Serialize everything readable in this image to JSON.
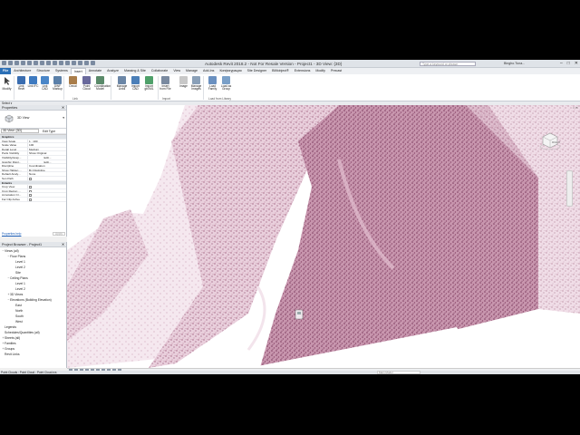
{
  "app": {
    "title": "Autodesk Revit 2018.2 - Not For Resale Version - Project1 - 3D View: {3D}",
    "search_placeholder": "Type a keyword or phrase",
    "user": "Bingho.Tuna...",
    "window_buttons": [
      "–",
      "□",
      "✕"
    ]
  },
  "ribbon": {
    "tabs": [
      "File",
      "Architecture",
      "Structure",
      "Systems",
      "Insert",
      "Annotate",
      "Analyze",
      "Massing & Site",
      "Collaborate",
      "View",
      "Manage",
      "Add-Ins",
      "Конфигурация",
      "Site Designer",
      "BIMobject®",
      "Extensions",
      "Modify",
      "Precast"
    ],
    "active_tab": "Insert",
    "modify_label": "Modify",
    "buttons": [
      {
        "label": "Link Revit",
        "icon": "link-revit-icon",
        "color": "#3a6db0"
      },
      {
        "label": "Link IFC",
        "icon": "link-ifc-icon",
        "color": "#3e7ac0"
      },
      {
        "label": "Link CAD",
        "icon": "link-cad-icon",
        "color": "#4a86c8"
      },
      {
        "label": "DWF Markup",
        "icon": "dwf-markup-icon",
        "color": "#5a7fa8"
      },
      {
        "label": "Decal",
        "icon": "decal-icon",
        "color": "#a97d4a"
      },
      {
        "label": "Point Cloud",
        "icon": "point-cloud-icon",
        "color": "#6a6a9c"
      },
      {
        "label": "Coordination Model",
        "icon": "coordination-model-icon",
        "color": "#5a8a6a"
      },
      {
        "label": "Manage Links",
        "icon": "manage-links-icon",
        "color": "#6b86a6"
      },
      {
        "label": "Import CAD",
        "icon": "import-cad-icon",
        "color": "#4b7fb8"
      },
      {
        "label": "Import gbXML",
        "icon": "import-gbxml-icon",
        "color": "#4fa06a"
      },
      {
        "label": "Insert from File",
        "icon": "insert-from-file-icon",
        "color": "#7a8aa0"
      },
      {
        "label": "Image",
        "icon": "image-icon",
        "color": "#c8c8c8"
      },
      {
        "label": "Manage Images",
        "icon": "manage-images-icon",
        "color": "#8aa0b8"
      },
      {
        "label": "Load Family",
        "icon": "load-family-icon",
        "color": "#6a90c0"
      },
      {
        "label": "Load as Group",
        "icon": "load-as-group-icon",
        "color": "#7aa0c8"
      }
    ],
    "panels": [
      "Link",
      "Import",
      "Load from Library"
    ]
  },
  "select_bar": "Select ▾",
  "properties": {
    "header": "Properties",
    "type_name": "3D View",
    "view_selector": "3D View: {3D}",
    "edit_type": "Edit Type",
    "rows": [
      {
        "cat": "Graphics"
      },
      {
        "k": "View Scale",
        "v": "1 : 100"
      },
      {
        "k": "Scale Value",
        "v": "100"
      },
      {
        "k": "Detail Level",
        "v": "Medium"
      },
      {
        "k": "Parts Visibility",
        "v": "Show Original"
      },
      {
        "k": "Visibility/Grap...",
        "v": "Edit...",
        "edit": true
      },
      {
        "k": "Graphic Displ...",
        "v": "Edit...",
        "edit": true
      },
      {
        "k": "Discipline",
        "v": "Coordination"
      },
      {
        "k": "Show Hidden ...",
        "v": "By Discipline"
      },
      {
        "k": "Default Analy...",
        "v": "None"
      },
      {
        "k": "Sun Path",
        "check": true
      },
      {
        "cat": "Extents"
      },
      {
        "k": "Crop View",
        "check": true
      },
      {
        "k": "Crop Region ...",
        "check": true
      },
      {
        "k": "Annotation Cr...",
        "check": true
      },
      {
        "k": "Far Clip Active",
        "check": true
      }
    ],
    "help_link": "Properties help",
    "apply": "Apply"
  },
  "project_browser": {
    "header": "Project Browser - Project1",
    "items": [
      {
        "label": "Views (all)",
        "indent": 0,
        "pm": "−"
      },
      {
        "label": "Floor Plans",
        "indent": 1,
        "pm": "−"
      },
      {
        "label": "Level 1",
        "indent": 2,
        "pm": ""
      },
      {
        "label": "Level 2",
        "indent": 2,
        "pm": ""
      },
      {
        "label": "Site",
        "indent": 2,
        "pm": ""
      },
      {
        "label": "Ceiling Plans",
        "indent": 1,
        "pm": "−"
      },
      {
        "label": "Level 1",
        "indent": 2,
        "pm": ""
      },
      {
        "label": "Level 2",
        "indent": 2,
        "pm": ""
      },
      {
        "label": "3D Views",
        "indent": 1,
        "pm": "+"
      },
      {
        "label": "Elevations (Building Elevation)",
        "indent": 1,
        "pm": "−"
      },
      {
        "label": "East",
        "indent": 2,
        "pm": ""
      },
      {
        "label": "North",
        "indent": 2,
        "pm": ""
      },
      {
        "label": "South",
        "indent": 2,
        "pm": ""
      },
      {
        "label": "West",
        "indent": 2,
        "pm": ""
      },
      {
        "label": "Legends",
        "indent": 0,
        "pm": ""
      },
      {
        "label": "Schedules/Quantities (all)",
        "indent": 0,
        "pm": ""
      },
      {
        "label": "Sheets (all)",
        "indent": 0,
        "pm": "+"
      },
      {
        "label": "Families",
        "indent": 0,
        "pm": "+"
      },
      {
        "label": "Groups",
        "indent": 0,
        "pm": "+"
      },
      {
        "label": "Revit Links",
        "indent": 0,
        "pm": ""
      }
    ]
  },
  "viewport": {
    "tab_label": "□ ✕",
    "viewcube_face": "RIGHT",
    "view_scale": "1 : 100",
    "point_cloud_color": "#a0607f"
  },
  "status": {
    "left": "Point Clouds : Point Cloud : Point Cloud.rcs",
    "model": "Main Model"
  }
}
